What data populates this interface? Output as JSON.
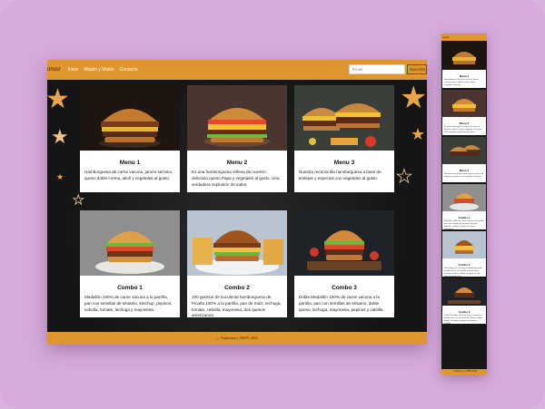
{
  "nav": {
    "brand": "onos!",
    "links": [
      "Inicio",
      "Misión y Visión",
      "Contacto"
    ],
    "search_placeholder": "Email",
    "button_label": "Suscribir"
  },
  "cards": [
    {
      "title": "Menu 1",
      "desc": "Hamburguesa de carne vacuna, jamón serrano, queso doble crema, aliolí y vegetales al gusto."
    },
    {
      "title": "Menu 2",
      "desc": "Es una hamburguesa rellena de nuestro delicioso queso Papa y vegetales al gusto. Una verdadera explosión de sabor."
    },
    {
      "title": "Menu 3",
      "desc": "Nuestra reconocida hamburguesa a base de lentejas y especias con vegetales al gusto."
    },
    {
      "title": "Combo 1",
      "desc": "Medallón 100% de carne vacuna a la parrilla, pan con semillas de sésamo, ketchup, pepinos, cebolla, tomate, lechuga y mayonesa."
    },
    {
      "title": "Combo 2",
      "desc": "100 gramos de suculenta hamburguesa de Picaña 100% a la parrilla, pan de maíz, lechuga, tomate, cebolla, mayonesa, dos quesos americanos."
    },
    {
      "title": "Combo 3",
      "desc": "Doble Medallón 100% de carne vacuna a la parrilla, pan con semillas de sésamo, doble queso, lechuga, mayonesa, pepinos y catsilla."
    }
  ],
  "footer": "— Todoonos | ©BPP-2022",
  "colors": {
    "accent": "#e0962e",
    "background": "#171717",
    "frame": "#d6abda"
  }
}
